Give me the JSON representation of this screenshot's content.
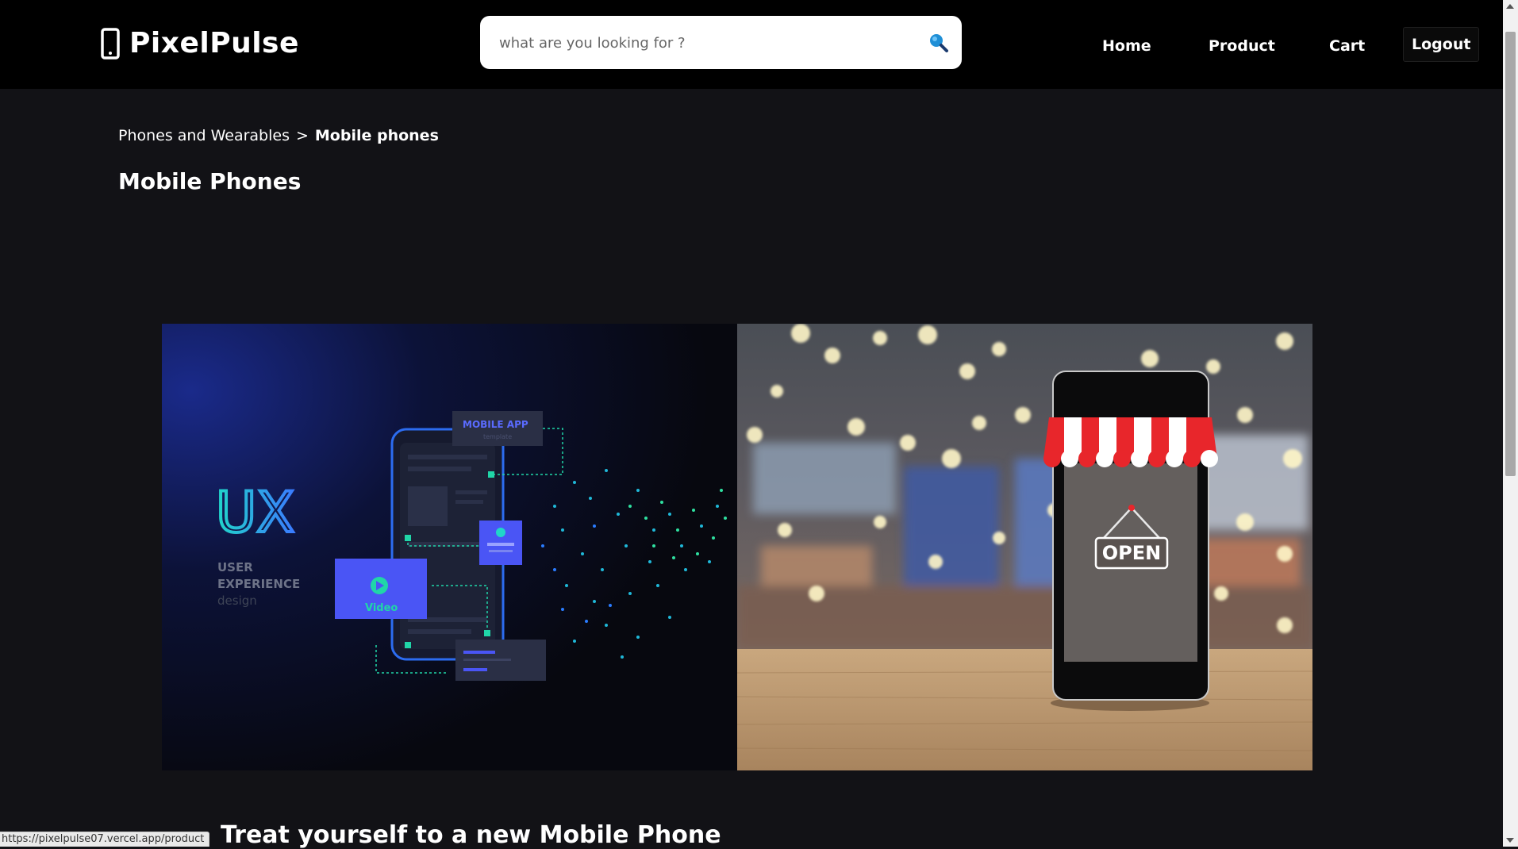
{
  "header": {
    "brand": "PixelPulse",
    "search": {
      "placeholder": "what are you looking for ?",
      "value": ""
    },
    "nav": {
      "home": "Home",
      "product": "Product",
      "cart": "Cart",
      "logout": "Logout"
    }
  },
  "breadcrumb": {
    "parent": "Phones and Wearables",
    "separator": ">",
    "current": "Mobile phones"
  },
  "page": {
    "title": "Mobile Phones",
    "section_heading": "Treat yourself to a new Mobile Phone"
  },
  "banner": {
    "left": {
      "big": "UX",
      "line1": "USER",
      "line2": "EXPERIENCE",
      "line3": "design",
      "card_title": "MOBILE APP",
      "card_sub": "template",
      "video_label": "Video"
    },
    "right": {
      "sign_text": "OPEN"
    }
  },
  "status_bar": {
    "url": "https://pixelpulse07.vercel.app/product"
  },
  "colors": {
    "header_bg": "#000000",
    "page_bg": "#121216",
    "accent_blue": "#4a55f5",
    "accent_teal": "#1ec8c0",
    "awning_red": "#e8262b"
  },
  "icons": {
    "logo": "smartphone-icon",
    "search": "search-icon"
  }
}
